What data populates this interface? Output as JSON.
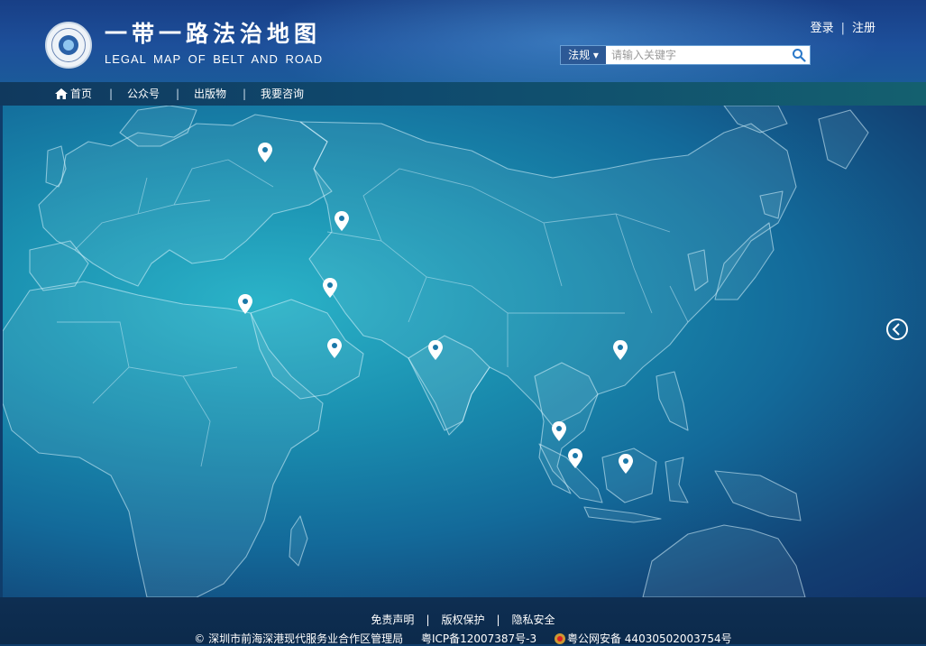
{
  "header": {
    "title_cn": "一带一路法治地图",
    "title_en": "LEGAL MAP OF BELT AND ROAD",
    "login_label": "登录",
    "register_label": "注册",
    "separator": "|"
  },
  "search": {
    "category_label": "法规 ▾",
    "placeholder": "请输入关键字",
    "value": ""
  },
  "nav": {
    "items": [
      {
        "label": "首页"
      },
      {
        "label": "公众号"
      },
      {
        "label": "出版物"
      },
      {
        "label": "我要咨询"
      }
    ],
    "separator": "|"
  },
  "map": {
    "marker_count": 11,
    "marker_icon": "map-pin-icon",
    "next_icon": "chevron-left-icon",
    "colors": {
      "ocean_center": "#2bb3c8",
      "ocean_edge": "#11326a",
      "outline": "#dcf5ff"
    }
  },
  "footer": {
    "links": [
      {
        "label": "免责声明"
      },
      {
        "label": "版权保护"
      },
      {
        "label": "隐私安全"
      }
    ],
    "separator": "|",
    "copyright": "© 深圳市前海深港现代服务业合作区管理局",
    "icp": "粤ICP备12007387号-3",
    "police": "粤公网安备 44030502003754号"
  }
}
